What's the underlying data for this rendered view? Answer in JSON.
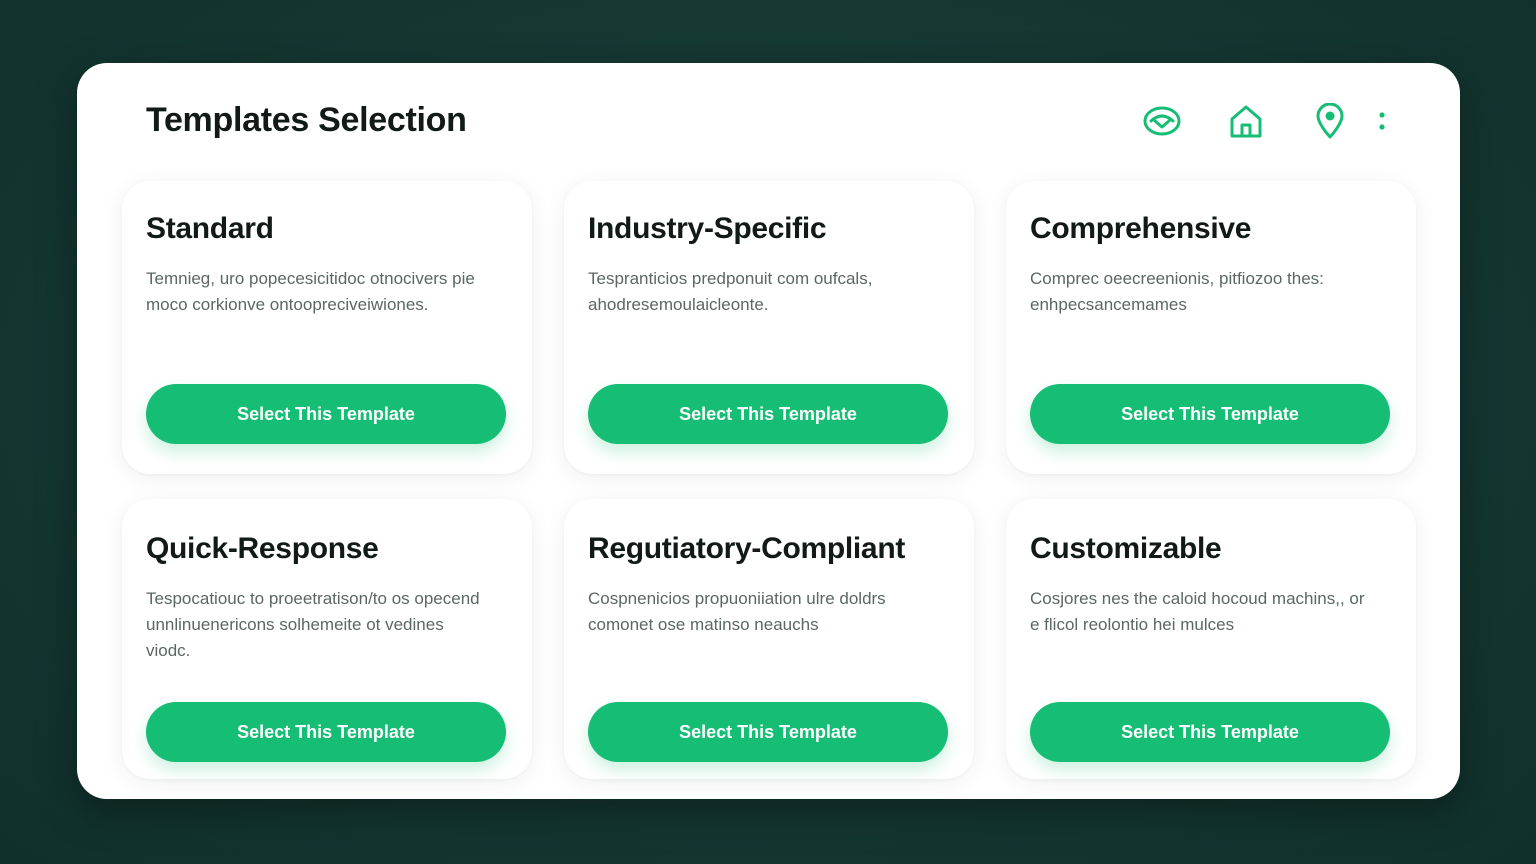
{
  "header": {
    "title": "Templates Selection",
    "icons": [
      "eye-badge-icon",
      "home-icon",
      "location-pin-icon",
      "more-vertical-icon"
    ]
  },
  "colors": {
    "accent": "#16bd74",
    "background": "#163a34",
    "panel": "#ffffff",
    "title_text": "#111a17",
    "desc_text": "#5b6763"
  },
  "templates": [
    {
      "title": "Standard",
      "description": "Temnieg, uro popecesicitidoc otnocivers pie moco corkionve ontoopreciveiwiones.",
      "button_label": "Select This Template"
    },
    {
      "title": "Industry-Specific",
      "description": "Tespranticios predponuit com oufcals, ahodresemoulaicleonte.",
      "button_label": "Select This Template"
    },
    {
      "title": "Comprehensive",
      "description": "Comprec oeecreenionis, pitfiozoo thes: enhpecsancemames",
      "button_label": "Select This Template"
    },
    {
      "title": "Quick-Response",
      "description": "Tespocatiouc to proeetratison/to os opecend unnlinuenericons solhemeite ot vedines viodc.",
      "button_label": "Select This Template"
    },
    {
      "title": "Regutiatory-Compliant",
      "description": "Cospnenicios propuoniiation ulre doldrs comonet ose matinso neauchs",
      "button_label": "Select This Template"
    },
    {
      "title": "Customizable",
      "description": "Cosjores nes the caloid hocoud machins,, or e flicol reolontio hei mulces",
      "button_label": "Select This Template"
    }
  ]
}
